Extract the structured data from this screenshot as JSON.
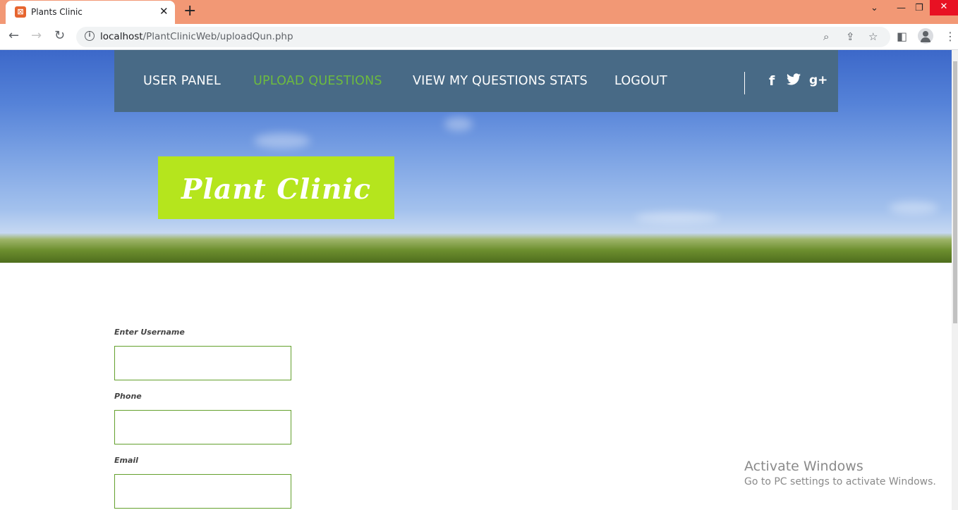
{
  "browser": {
    "tab_title": "Plants Clinic",
    "tab_close": "✕",
    "new_tab": "+",
    "url_host": "localhost",
    "url_path": "/PlantClinicWeb/uploadQun.php",
    "window_controls": {
      "minimize": "—",
      "restore": "❐",
      "close": "✕",
      "dropdown": "⌄"
    }
  },
  "nav": {
    "items": [
      {
        "label": "USER PANEL",
        "active": false
      },
      {
        "label": "UPLOAD QUESTIONS",
        "active": true
      },
      {
        "label": "VIEW MY QUESTIONS STATS",
        "active": false
      },
      {
        "label": "LOGOUT",
        "active": false
      }
    ],
    "social": {
      "facebook": "f",
      "twitter": "🐦",
      "google_plus": "g+"
    },
    "active_color": "#6dbb3f",
    "bar_color": "#486a86"
  },
  "logo": {
    "text": "Plant Clinic",
    "background": "#b5e51d"
  },
  "form": {
    "fields": [
      {
        "label": "Enter Username",
        "value": ""
      },
      {
        "label": "Phone",
        "value": ""
      },
      {
        "label": "Email",
        "value": ""
      }
    ],
    "border_color": "#63a02c"
  },
  "watermark": {
    "title": "Activate Windows",
    "subtitle": "Go to PC settings to activate Windows."
  }
}
